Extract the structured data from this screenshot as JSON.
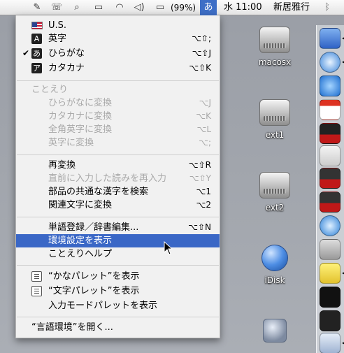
{
  "menubar": {
    "battery": "(99%)",
    "input_mode": "あ",
    "clock": "水 11:00",
    "user": "新居雅行"
  },
  "desktop": {
    "icons": [
      {
        "label": "macosx"
      },
      {
        "label": "ext1"
      },
      {
        "label": "ext2"
      },
      {
        "label": "iDisk"
      }
    ]
  },
  "menu": {
    "input_methods": [
      {
        "label": "U.S.",
        "shortcut": ""
      },
      {
        "label": "英字",
        "shortcut": "⌥⇧;"
      },
      {
        "label": "ひらがな",
        "shortcut": "⌥⇧J"
      },
      {
        "label": "カタカナ",
        "shortcut": "⌥⇧K"
      }
    ],
    "kotoeri_header": "ことえり",
    "convert": [
      {
        "label": "ひらがなに変換",
        "shortcut": "⌥J"
      },
      {
        "label": "カタカナに変換",
        "shortcut": "⌥K"
      },
      {
        "label": "全角英字に変換",
        "shortcut": "⌥L"
      },
      {
        "label": "英字に変換",
        "shortcut": "⌥;"
      }
    ],
    "actions": [
      {
        "label": "再変換",
        "shortcut": "⌥⇧R"
      },
      {
        "label": "直前に入力した読みを再入力",
        "shortcut": "⌥⇧Y"
      },
      {
        "label": "部品の共通な漢字を検索",
        "shortcut": "⌥1"
      },
      {
        "label": "関連文字に変換",
        "shortcut": "⌥2"
      }
    ],
    "dictionary": [
      {
        "label": "単語登録／辞書編集...",
        "shortcut": "⌥⇧N"
      },
      {
        "label": "環境設定を表示",
        "shortcut": ""
      },
      {
        "label": "ことえりヘルプ",
        "shortcut": ""
      }
    ],
    "palettes": [
      {
        "label": "“かなパレット”を表示"
      },
      {
        "label": "“文字パレット”を表示"
      },
      {
        "label": "入力モードパレットを表示"
      }
    ],
    "open_language": "“言語環境”を開く..."
  }
}
